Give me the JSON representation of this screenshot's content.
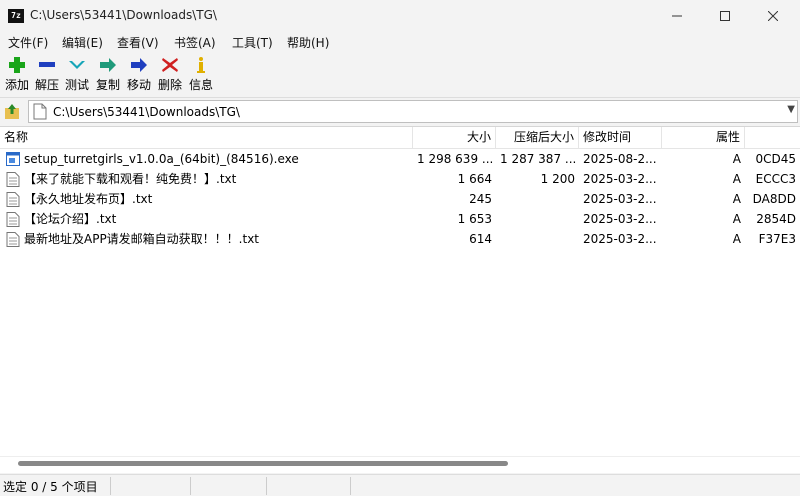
{
  "window": {
    "title": "C:\\Users\\53441\\Downloads\\TG\\",
    "app_icon_text": "7z"
  },
  "menu": [
    "文件(F)",
    "编辑(E)",
    "查看(V)",
    "书签(A)",
    "工具(T)",
    "帮助(H)"
  ],
  "toolbar": [
    {
      "label": "添加",
      "icon": "add-icon",
      "color": "#1aa51a"
    },
    {
      "label": "解压",
      "icon": "extract-icon",
      "color": "#1f3fbf"
    },
    {
      "label": "测试",
      "icon": "test-icon",
      "color": "#16a5b8"
    },
    {
      "label": "复制",
      "icon": "copy-icon",
      "color": "#1f9a7a"
    },
    {
      "label": "移动",
      "icon": "move-icon",
      "color": "#1f3fbf"
    },
    {
      "label": "删除",
      "icon": "delete-icon",
      "color": "#d02020"
    },
    {
      "label": "信息",
      "icon": "info-icon",
      "color": "#e0b000"
    }
  ],
  "address": {
    "path": "C:\\Users\\53441\\Downloads\\TG\\"
  },
  "columns": {
    "name": "名称",
    "size": "大小",
    "packed": "压缩后大小",
    "modified": "修改时间",
    "attributes": "属性",
    "crc": ""
  },
  "files": [
    {
      "name": "setup_turretgirls_v1.0.0a_(64bit)_(84516).exe",
      "size": "1 298 639 ...",
      "packed": "1 287 387 ...",
      "modified": "2025-08-2...",
      "attr": "A",
      "crc": "0CD45",
      "icon": "exe-icon"
    },
    {
      "name": "【来了就能下载和观看！纯免费！】.txt",
      "size": "1 664",
      "packed": "1 200",
      "modified": "2025-03-2...",
      "attr": "A",
      "crc": "ECCC3",
      "icon": "txt-icon"
    },
    {
      "name": "【永久地址发布页】.txt",
      "size": "245",
      "packed": "",
      "modified": "2025-03-2...",
      "attr": "A",
      "crc": "DA8DD",
      "icon": "txt-icon"
    },
    {
      "name": "【论坛介绍】.txt",
      "size": "1 653",
      "packed": "",
      "modified": "2025-03-2...",
      "attr": "A",
      "crc": "2854D",
      "icon": "txt-icon"
    },
    {
      "name": "最新地址及APP请发邮箱自动获取！！！.txt",
      "size": "614",
      "packed": "",
      "modified": "2025-03-2...",
      "attr": "A",
      "crc": "F37E3",
      "icon": "txt-icon"
    }
  ],
  "status": {
    "text": "选定 0 / 5 个项目"
  }
}
